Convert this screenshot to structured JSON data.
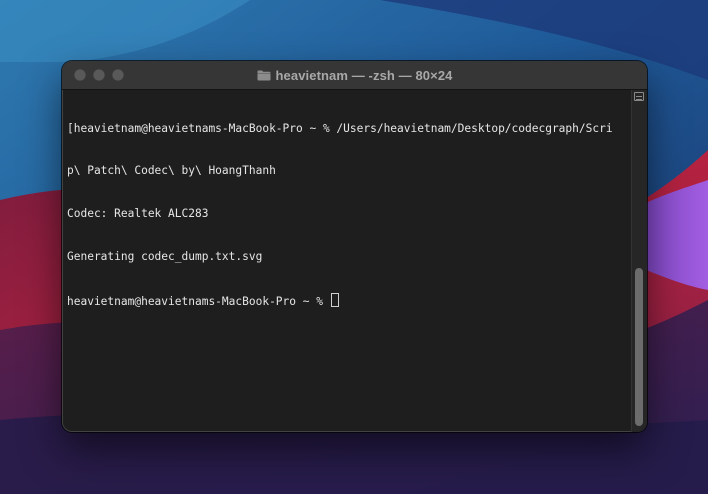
{
  "window": {
    "title": "heavietnam — -zsh — 80×24"
  },
  "terminal": {
    "lines": [
      "[heavietnam@heavietnams-MacBook-Pro ~ % /Users/heavietnam/Desktop/codecgraph/Scri",
      "p\\ Patch\\ Codec\\ by\\ HoangThanh",
      "Codec: Realtek ALC283",
      "Generating codec_dump.txt.svg",
      "heavietnam@heavietnams-MacBook-Pro ~ % "
    ]
  },
  "colors": {
    "terminal_background": "#1e1e1e",
    "terminal_text": "#e6e6e6",
    "titlebar": "#363636"
  },
  "icons": {
    "title_icon": "folder-icon",
    "scroll_corner": "split-pane-icon"
  }
}
